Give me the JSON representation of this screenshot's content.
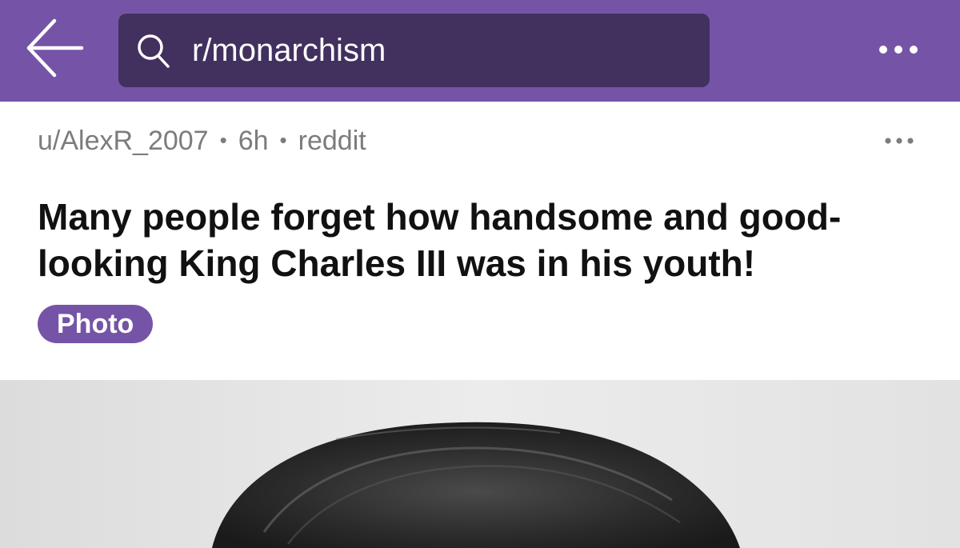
{
  "topbar": {
    "background": "#7554a7",
    "back_icon": "arrow-left-icon",
    "search": {
      "icon": "search-icon",
      "value": "r/monarchism"
    },
    "more_icon": "more-horizontal-icon"
  },
  "post": {
    "author": "u/AlexR_2007",
    "separator": "•",
    "age": "6h",
    "source": "reddit",
    "more_icon": "more-horizontal-icon",
    "title": "Many people forget how handsome and good-looking King Charles III was in his youth!",
    "flair": "Photo",
    "flair_color": "#7554a7"
  },
  "image": {
    "kind": "black-and-white portrait photo (top of head visible)"
  }
}
